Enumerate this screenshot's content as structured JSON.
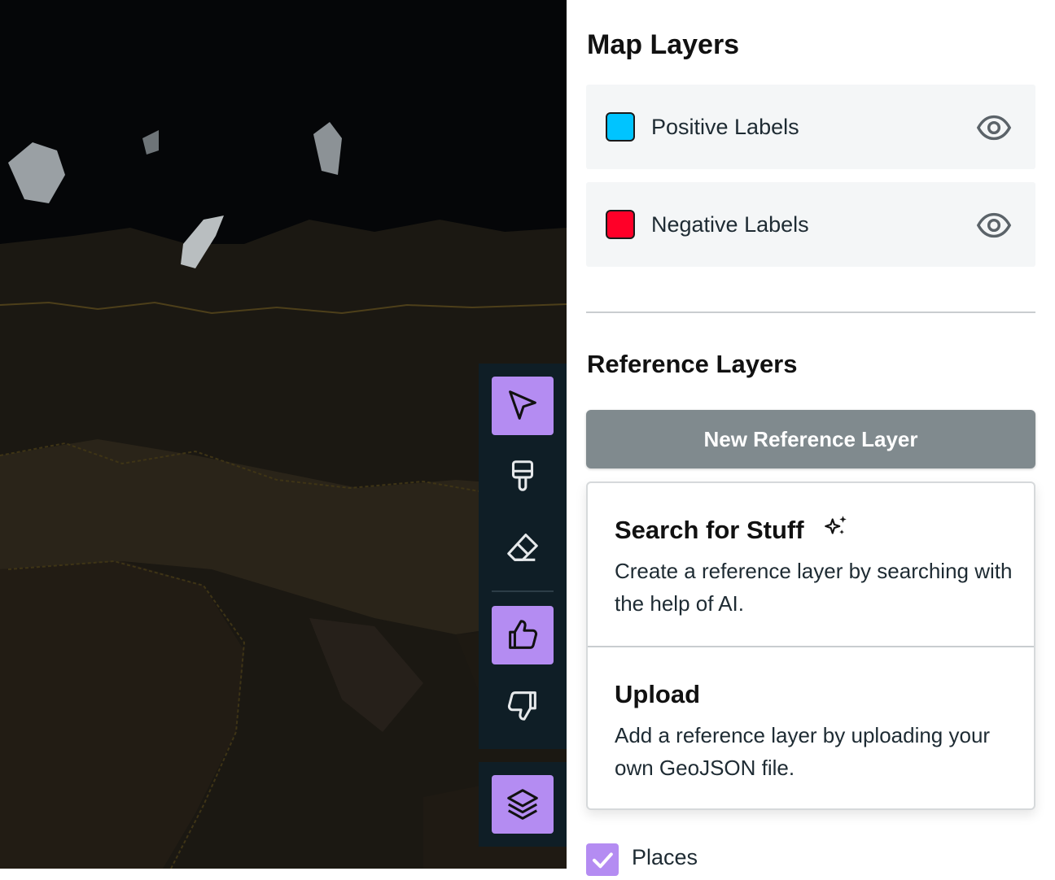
{
  "panel": {
    "map_layers_title": "Map Layers",
    "layers": [
      {
        "label": "Positive Labels",
        "color": "#00c4ff",
        "icon": "eye-icon"
      },
      {
        "label": "Negative Labels",
        "color": "#ff0028",
        "icon": "eye-icon"
      }
    ],
    "reference_layers_title": "Reference Layers",
    "new_reference_button": "New Reference Layer",
    "menu": [
      {
        "title": "Search for Stuff",
        "description": "Create a reference layer by searching with the help of AI.",
        "icon": "sparkles-icon"
      },
      {
        "title": "Upload",
        "description": "Add a reference layer by uploading your own GeoJSON file."
      }
    ],
    "places": {
      "label": "Places",
      "checked": true
    }
  },
  "toolbar": {
    "tools": [
      {
        "name": "select",
        "icon": "cursor-arrow-icon",
        "active": true
      },
      {
        "name": "paint",
        "icon": "paint-brush-icon",
        "active": false
      },
      {
        "name": "erase",
        "icon": "eraser-icon",
        "active": false
      },
      {
        "name": "positive",
        "icon": "thumbs-up-icon",
        "active": true
      },
      {
        "name": "negative",
        "icon": "thumbs-down-icon",
        "active": false
      }
    ],
    "layers_toggle": {
      "icon": "layers-stack-icon",
      "active": true
    }
  },
  "colors": {
    "accent": "#b48cf2",
    "toolbar_bg": "#0f1e26",
    "map_bg": "#050608",
    "button_gray": "#808a8e"
  }
}
